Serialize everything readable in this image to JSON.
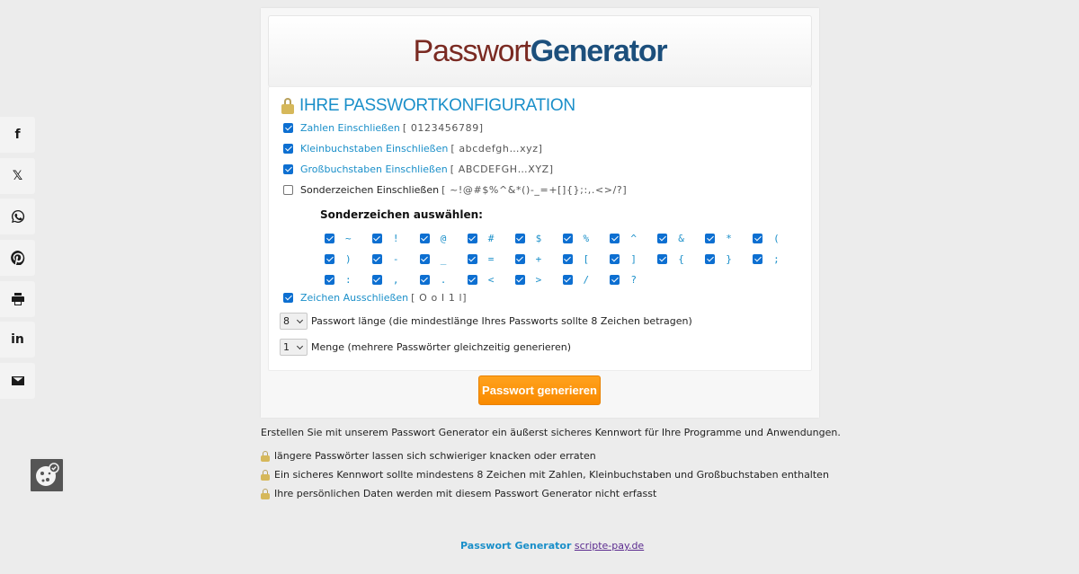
{
  "share": [
    "f",
    "𝕏",
    "whatsapp",
    "pinterest",
    "print",
    "in",
    "email"
  ],
  "logo": {
    "part1": "Passwort",
    "part2": "Generator"
  },
  "config_title": "IHRE PASSWORTKONFIGURATION",
  "options": [
    {
      "label": "Zahlen Einschließen",
      "chars": "[ 0123456789]",
      "checked": true
    },
    {
      "label": "Kleinbuchstaben Einschließen",
      "chars": "[ abcdefgh…xyz]",
      "checked": true
    },
    {
      "label": "Großbuchstaben Einschließen",
      "chars": "[ ABCDEFGH…XYZ]",
      "checked": true
    },
    {
      "label": "Sonderzeichen Einschließen",
      "chars": "[ ~!@#$%^&*()-_=+[]{};:,.<>/?]",
      "checked": false
    }
  ],
  "special_heading": "Sonderzeichen auswählen:",
  "special_chars": [
    "~",
    "!",
    "@",
    "#",
    "$",
    "%",
    "^",
    "&",
    "*",
    "(",
    ")",
    "-",
    "_",
    "=",
    "+",
    "[",
    "]",
    "{",
    "}",
    ";",
    ":",
    ",",
    ".",
    "<",
    ">",
    "/",
    "?"
  ],
  "exclude": {
    "label": "Zeichen Ausschließen",
    "chars": "[ O o I 1 l]",
    "checked": true
  },
  "length": {
    "value": "8",
    "label": "Passwort länge (die mindestlänge Ihres Passworts sollte 8 Zeichen betragen)"
  },
  "quantity": {
    "value": "1",
    "label": "Menge (mehrere Passwörter gleichzeitig generieren)"
  },
  "generate_button": "Passwort generieren",
  "intro": "Erstellen Sie mit unserem Passwort Generator ein äußerst sicheres Kennwort für Ihre Programme und Anwendungen.",
  "tips": [
    "längere Passwörter lassen sich schwieriger knacken oder erraten",
    "Ein sicheres Kennwort sollte mindestens 8 Zeichen mit Zahlen, Kleinbuchstaben und Großbuchstaben enthalten",
    "Ihre persönlichen Daten werden mit diesem Passwort Generator nicht erfasst"
  ],
  "footer": {
    "brand": "Passwort Generator",
    "link": "scripte-pay.de"
  }
}
